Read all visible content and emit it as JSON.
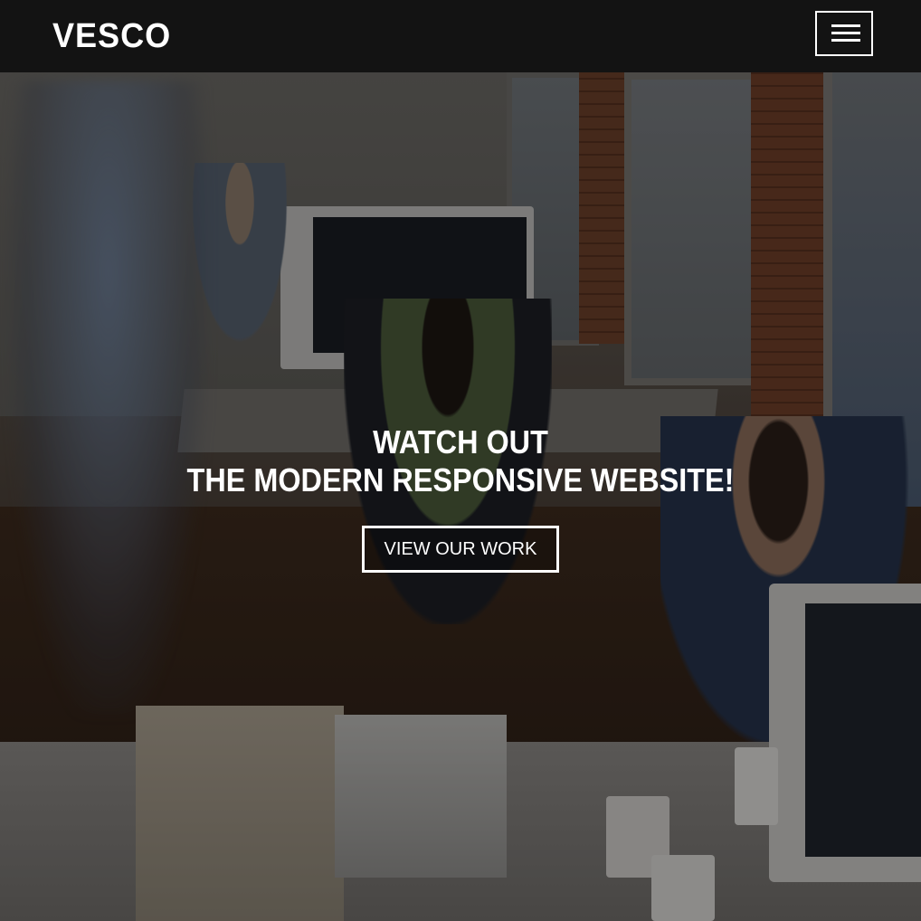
{
  "navbar": {
    "brand": "VESCO",
    "menu_icon": "hamburger-menu-icon"
  },
  "hero": {
    "headline_line1": "WATCH OUT",
    "headline_line2": "THE MODERN RESPONSIVE WEBSITE!",
    "cta_label": "VIEW OUR WORK",
    "background_image": "office workspace with people at computers"
  },
  "colors": {
    "navbar_bg": "#111111",
    "text": "#ffffff"
  }
}
